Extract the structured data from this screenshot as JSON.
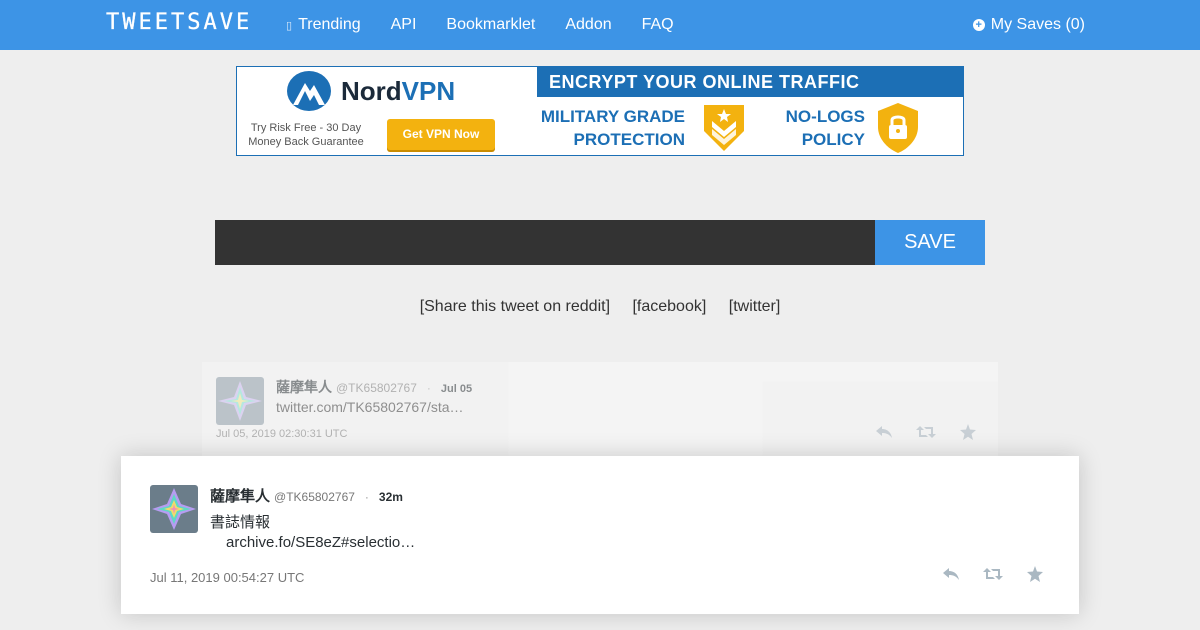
{
  "navbar": {
    "brand": "TWEETSAVE",
    "links": [
      {
        "label": "Trending",
        "icon": "hash-icon"
      },
      {
        "label": "API"
      },
      {
        "label": "Bookmarklet"
      },
      {
        "label": "Addon"
      },
      {
        "label": "FAQ"
      }
    ],
    "my_saves": "My Saves (0)"
  },
  "ad": {
    "logo_a": "Nord",
    "logo_b": "VPN",
    "tagline_line1": "Try Risk Free - 30 Day",
    "tagline_line2": "Money Back Guarantee",
    "cta": "Get VPN Now",
    "headline": "ENCRYPT YOUR ONLINE TRAFFIC",
    "feature1_line1": "MILITARY GRADE",
    "feature1_line2": "PROTECTION",
    "feature2_line1": "NO-LOGS",
    "feature2_line2": "POLICY"
  },
  "save_form": {
    "input_value": "",
    "button_label": "SAVE"
  },
  "share": {
    "reddit": "[Share this tweet on reddit]",
    "facebook": "[facebook]",
    "twitter": "[twitter]"
  },
  "tweets": [
    {
      "name": "薩摩隼人",
      "handle": "@TK65802767",
      "sep": "·",
      "time": "Jul 05",
      "body": "twitter.com/TK65802767/sta…",
      "date": "Jul 05, 2019 02:30:31 UTC"
    },
    {
      "name": "薩摩隼人",
      "handle": "@TK65802767",
      "sep": "·",
      "time": "32m",
      "body_line1": "書誌情報",
      "body_line2": "archive.fo/SE8eZ#selectio…",
      "date": "Jul 11, 2019 00:54:27 UTC"
    }
  ],
  "colors": {
    "navbar": "#3d94e6",
    "input_bg": "#333333",
    "page_bg": "#eeeeee",
    "ad_blue": "#1c6fb5",
    "ad_yellow": "#f3b20f"
  }
}
